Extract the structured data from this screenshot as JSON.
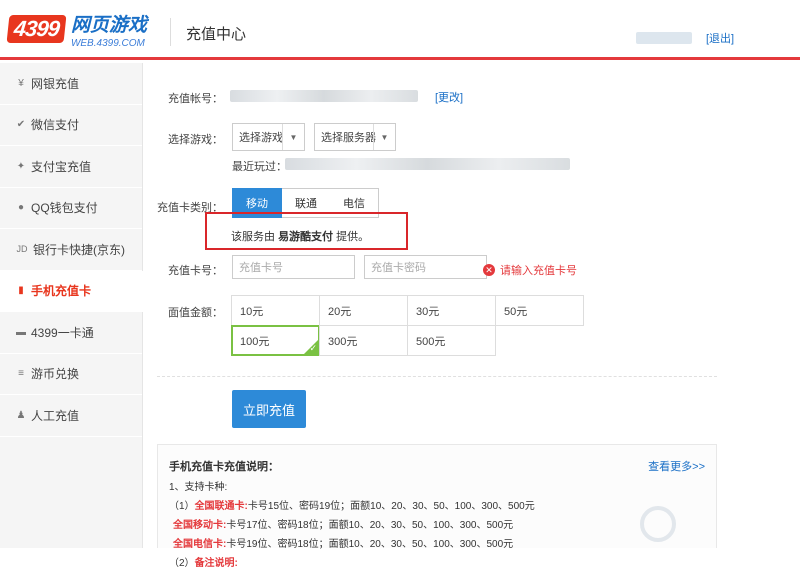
{
  "header": {
    "logo_num": "4399",
    "logo_text": "网页游戏",
    "logo_url": "WEB.4399.COM",
    "title": "充值中心",
    "logout": "[退出]"
  },
  "sidebar": {
    "items": [
      {
        "icon": "yen-icon",
        "glyph": "¥",
        "label": "网银充值"
      },
      {
        "icon": "wechat-icon",
        "glyph": "✔",
        "label": "微信支付"
      },
      {
        "icon": "alipay-icon",
        "glyph": "✦",
        "label": "支付宝充值"
      },
      {
        "icon": "qq-icon",
        "glyph": "●",
        "label": "QQ钱包支付"
      },
      {
        "icon": "jd-icon",
        "glyph": "JD",
        "label": "银行卡快捷(京东)"
      },
      {
        "icon": "phone-icon",
        "glyph": "▮",
        "label": "手机充值卡",
        "active": true
      },
      {
        "icon": "card-icon",
        "glyph": "▬",
        "label": "4399一卡通"
      },
      {
        "icon": "coin-icon",
        "glyph": "≡",
        "label": "游币兑换"
      },
      {
        "icon": "person-icon",
        "glyph": "♟",
        "label": "人工充值"
      }
    ]
  },
  "form": {
    "account_label": "充值帐号：",
    "change_link": "[更改]",
    "game_label": "选择游戏：",
    "game_select": "选择游戏",
    "server_select": "选择服务器",
    "recent_label": "最近玩过：",
    "cardtype_label": "充值卡类别：",
    "tabs": [
      "移动",
      "联通",
      "电信"
    ],
    "notice_prefix": "该服务由 ",
    "notice_bold": "易游酷支付",
    "notice_suffix": " 提供。",
    "cardno_label": "充值卡号：",
    "cardno_placeholder": "充值卡号",
    "cardpwd_placeholder": "充值卡密码",
    "error": "请输入充值卡号",
    "amount_label": "面值金额：",
    "amounts": [
      "10元",
      "20元",
      "30元",
      "50元",
      "100元",
      "300元",
      "500元"
    ],
    "selected_amount": "100元",
    "submit": "立即充值"
  },
  "info": {
    "title": "手机充值卡充值说明：",
    "more": "查看更多>>",
    "line1": "1、支持卡种:",
    "line2_prefix": "（1）",
    "line2_red": "全国联通卡:",
    "line2_text": "卡号15位、密码19位；面额10、20、30、50、100、300、500元",
    "line3_red": "全国移动卡:",
    "line3_text": "卡号17位、密码18位；面额10、20、30、50、100、300、500元",
    "line4_red": "全国电信卡:",
    "line4_text": "卡号19位、密码18位；面额10、20、30、50、100、300、500元",
    "line5_prefix": "（2）",
    "line5_red": "备注说明:"
  }
}
